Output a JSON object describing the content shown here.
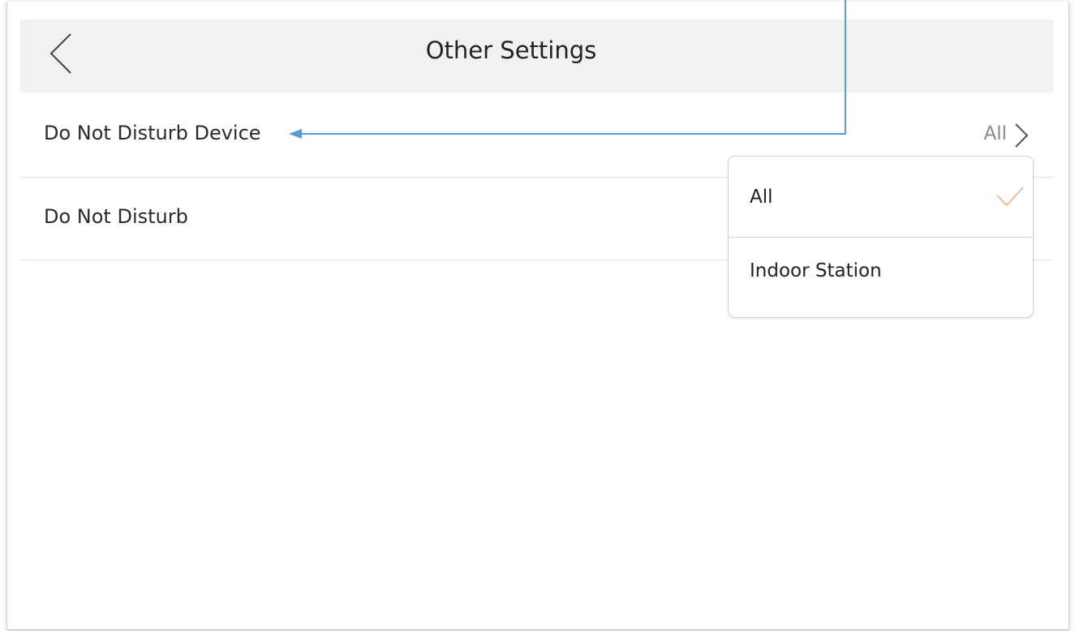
{
  "header": {
    "title": "Other Settings",
    "back_icon": "chevron-left-icon"
  },
  "settings": [
    {
      "label": "Do Not Disturb Device",
      "value": "All",
      "icon": "chevron-right-icon"
    },
    {
      "label": "Do Not Disturb"
    }
  ],
  "dropdown": {
    "options": [
      {
        "label": "All",
        "selected": true,
        "icon": "checkmark-icon"
      },
      {
        "label": "Indoor Station",
        "selected": false
      }
    ]
  },
  "colors": {
    "header_bg": "#f1f1f1",
    "check": "#f2b07a",
    "annotation_line": "#5b9bd5",
    "value_text": "#8a8a8a"
  }
}
